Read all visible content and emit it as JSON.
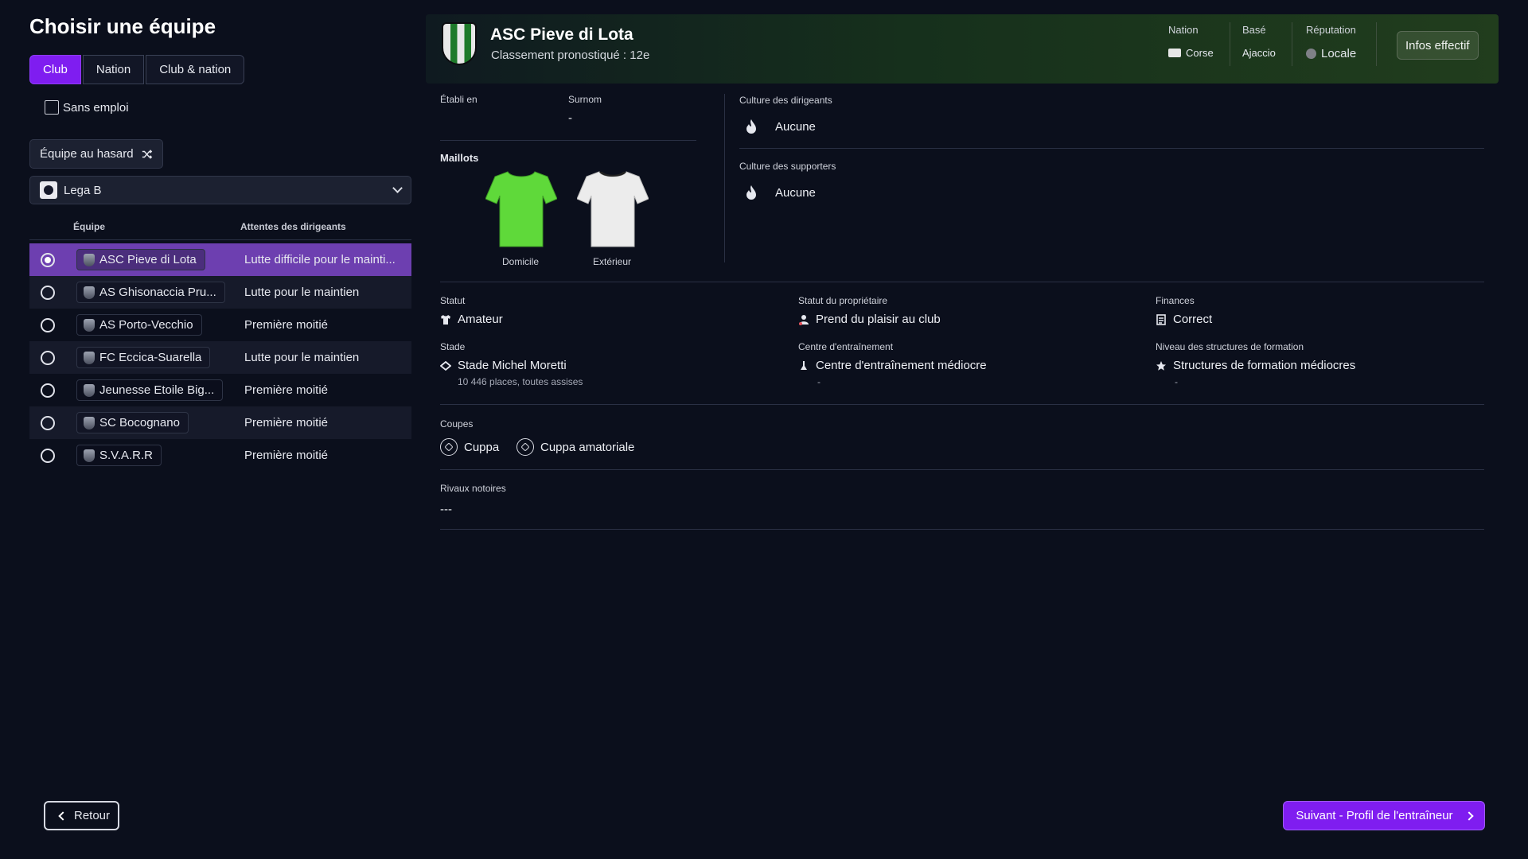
{
  "page": {
    "title": "Choisir une équipe"
  },
  "tabs": [
    {
      "label": "Club"
    },
    {
      "label": "Nation"
    },
    {
      "label": "Club & nation"
    }
  ],
  "unemployed_label": "Sans emploi",
  "random_team_label": "Équipe au hasard",
  "league": {
    "selected": "Lega B"
  },
  "table": {
    "col_team": "Équipe",
    "col_expectation": "Attentes des dirigeants",
    "rows": [
      {
        "team": "ASC Pieve di Lota",
        "expectation": "Lutte difficile pour le mainti..."
      },
      {
        "team": "AS Ghisonaccia Pru...",
        "expectation": "Lutte pour le maintien"
      },
      {
        "team": "AS Porto-Vecchio",
        "expectation": "Première moitié"
      },
      {
        "team": "FC Eccica-Suarella",
        "expectation": "Lutte pour le maintien"
      },
      {
        "team": "Jeunesse Etoile Big...",
        "expectation": "Première moitié"
      },
      {
        "team": "SC Bocognano",
        "expectation": "Première moitié"
      },
      {
        "team": "S.V.A.R.R",
        "expectation": "Première moitié"
      }
    ]
  },
  "club": {
    "name": "ASC Pieve di Lota",
    "rank": "Classement pronostiqué : 12e",
    "nation_label": "Nation",
    "nation_value": "Corse",
    "based_label": "Basé",
    "based_value": "Ajaccio",
    "reputation_label": "Réputation",
    "reputation_value": "Locale",
    "squad_button": "Infos effectif"
  },
  "details": {
    "founded_label": "Établi en",
    "founded_value": "",
    "nickname_label": "Surnom",
    "nickname_value": "-",
    "kits_label": "Maillots",
    "kit_home_label": "Domicile",
    "kit_away_label": "Extérieur",
    "kit_home_color": "#5fd93a",
    "kit_away_color": "#ececec",
    "board_culture_label": "Culture des dirigeants",
    "board_culture_value": "Aucune",
    "fan_culture_label": "Culture des supporters",
    "fan_culture_value": "Aucune",
    "status_label": "Statut",
    "status_value": "Amateur",
    "owner_label": "Statut du propriétaire",
    "owner_value": "Prend du plaisir au club",
    "finances_label": "Finances",
    "finances_value": "Correct",
    "stadium_label": "Stade",
    "stadium_value": "Stade Michel Moretti",
    "stadium_sub": "10 446 places, toutes assises",
    "training_label": "Centre d'entraînement",
    "training_value": "Centre d'entraînement médiocre",
    "training_sub": "-",
    "youth_label": "Niveau des structures de formation",
    "youth_value": "Structures de formation médiocres",
    "youth_sub": "-",
    "cups_label": "Coupes",
    "cups": [
      "Cuppa",
      "Cuppa amatoriale"
    ],
    "rivals_label": "Rivaux notoires",
    "rivals_value": "---"
  },
  "footer": {
    "back_label": "Retour",
    "next_label": "Suivant - Profil de l'entraîneur"
  }
}
